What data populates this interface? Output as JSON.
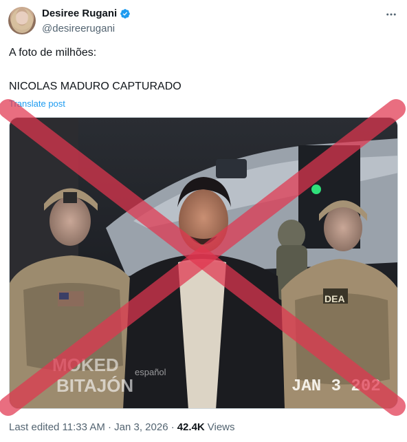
{
  "author": {
    "display_name": "Desiree Rugani",
    "handle": "@desireerugani",
    "verified": true,
    "verified_color": "#1d9bf0"
  },
  "post": {
    "text_line1": "A foto de milhões:",
    "text_line2": "NICOLAS MADURO CAPTURADO",
    "translate_label": "Translate post",
    "more_icon": "more-horizontal-icon"
  },
  "media": {
    "watermark_top": "MOKED",
    "watermark_lang": "español",
    "watermark_bottom": "BITAJÓN",
    "date_stamp": "JAN  3  202",
    "patch_label": "DEA",
    "overlay": "red-x",
    "overlay_color": "#e0364f"
  },
  "footer": {
    "edited": "Last edited 11:33 AM · Jan 3, 2026 ·",
    "views_count": "42.4K",
    "views_label": "Views"
  }
}
